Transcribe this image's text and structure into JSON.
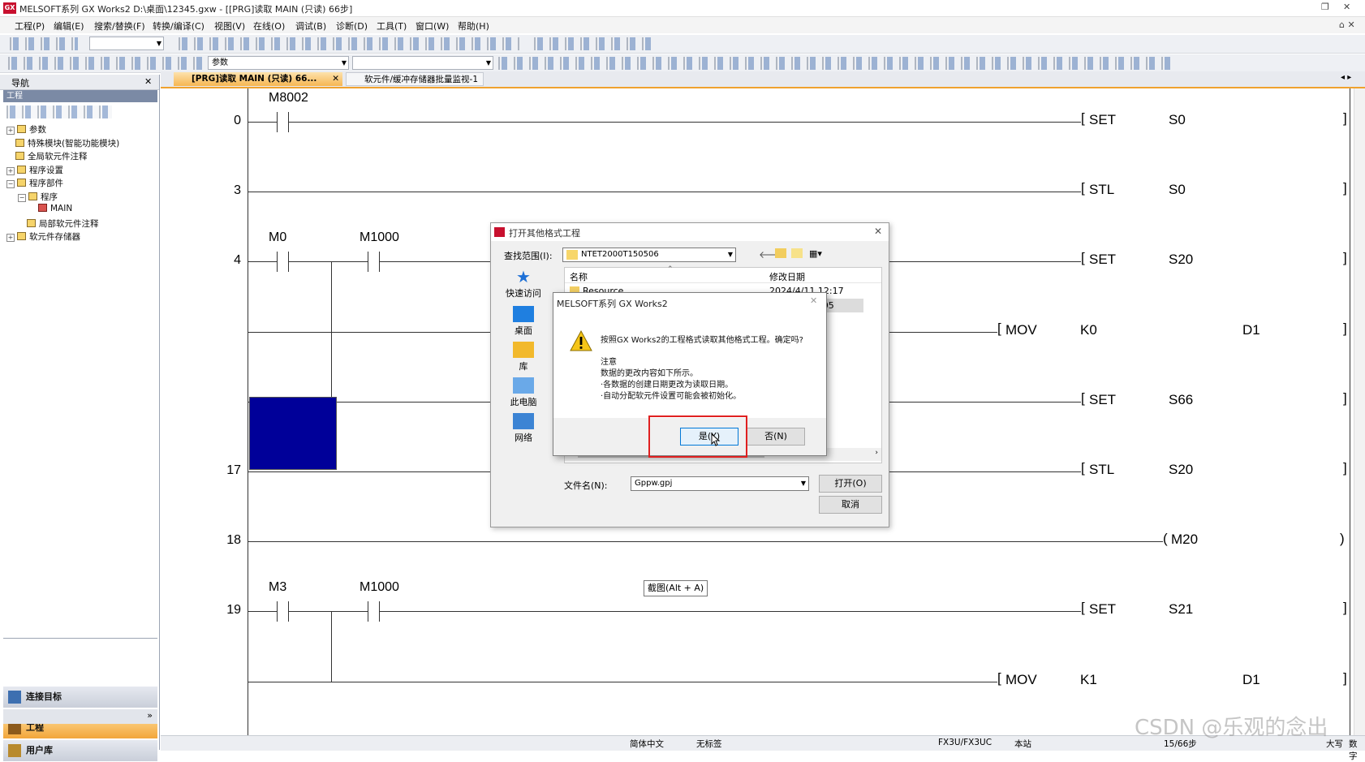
{
  "window": {
    "app_title": "MELSOFT系列 GX Works2 D:\\桌面\\12345.gxw - [[PRG]读取 MAIN (只读) 66步]"
  },
  "menu": [
    "工程(P)",
    "编辑(E)",
    "搜索/替换(F)",
    "转换/编译(C)",
    "视图(V)",
    "在线(O)",
    "调试(B)",
    "诊断(D)",
    "工具(T)",
    "窗口(W)",
    "帮助(H)"
  ],
  "toolbar": {
    "param_combo": "参数"
  },
  "nav": {
    "title": "导航",
    "pin": "ᵖ",
    "close": "✕",
    "section": "工程",
    "tree": [
      {
        "label": "参数",
        "indent": 0,
        "pm": "+"
      },
      {
        "label": "特殊模块(智能功能模块)",
        "indent": 0,
        "pm": ""
      },
      {
        "label": "全局软元件注释",
        "indent": 0,
        "pm": ""
      },
      {
        "label": "程序设置",
        "indent": 0,
        "pm": "+"
      },
      {
        "label": "程序部件",
        "indent": 0,
        "pm": "−"
      },
      {
        "label": "程序",
        "indent": 1,
        "pm": "−"
      },
      {
        "label": "MAIN",
        "indent": 2,
        "pm": ""
      },
      {
        "label": "局部软元件注释",
        "indent": 1,
        "pm": ""
      },
      {
        "label": "软元件存储器",
        "indent": 0,
        "pm": "+"
      }
    ],
    "buttons": [
      "工程",
      "用户库",
      "连接目标"
    ]
  },
  "tabs": [
    {
      "label": "[PRG]读取 MAIN (只读) 66...",
      "active": true
    },
    {
      "label": "软元件/缓冲存储器批量监视-1",
      "active": false
    }
  ],
  "ladder": {
    "rungs": [
      {
        "step": "0",
        "contacts": [
          "M8002"
        ],
        "instr": "SET",
        "op1": "S0",
        "op2": ""
      },
      {
        "step": "3",
        "contacts": [],
        "instr": "STL",
        "op1": "S0",
        "op2": ""
      },
      {
        "step": "4",
        "contacts": [
          "M0",
          "M1000"
        ],
        "instr": "SET",
        "op1": "S20",
        "op2": ""
      },
      {
        "step": "",
        "contacts": [],
        "instr": "MOV",
        "op1": "K0",
        "op2": "D1"
      },
      {
        "step": "",
        "contacts": [],
        "instr": "SET",
        "op1": "S66",
        "op2": ""
      },
      {
        "step": "17",
        "contacts": [],
        "instr": "STL",
        "op1": "S20",
        "op2": ""
      },
      {
        "step": "18",
        "contacts": [],
        "instr": "",
        "op1": "M20",
        "op2": ""
      },
      {
        "step": "19",
        "contacts": [
          "M3",
          "M1000"
        ],
        "instr": "SET",
        "op1": "S21",
        "op2": ""
      },
      {
        "step": "",
        "contacts": [],
        "instr": "MOV",
        "op1": "K1",
        "op2": "D1"
      }
    ],
    "tooltip": "截图(Alt + A)"
  },
  "file_dialog": {
    "title": "打开其他格式工程",
    "look_in_label": "查找范围(I):",
    "look_in_value": "NTET2000T150506",
    "places": [
      "快速访问",
      "桌面",
      "库",
      "此电脑",
      "网络"
    ],
    "col_name": "名称",
    "col_date": "修改日期",
    "rows": [
      {
        "name": "Resource",
        "date": "2024/4/11 12:17"
      },
      {
        "name": "",
        "date": "21:05"
      }
    ],
    "filename_label": "文件名(N):",
    "filename_value": "Gppw.gpj",
    "open_button": "打开(O)",
    "cancel_button": "取消"
  },
  "confirm": {
    "title": "MELSOFT系列 GX Works2",
    "line1": "按照GX Works2的工程格式读取其他格式工程。确定吗?",
    "note": "注意",
    "line2": "数据的更改内容如下所示。",
    "line3": "·各数据的创建日期更改为读取日期。",
    "line4": "·自动分配软元件设置可能会被初始化。",
    "yes": "是(Y)",
    "no": "否(N)"
  },
  "status": {
    "lang": "简体中文",
    "label": "无标签",
    "cpu": "FX3U/FX3UC",
    "station": "本站",
    "steps": "15/66步",
    "mode": "大写",
    "num": "数字"
  },
  "watermark": "CSDN @乐观的念出",
  "colors": {
    "accent": "#f0a22e",
    "selection": "#000099",
    "highlight": "#e02020"
  }
}
